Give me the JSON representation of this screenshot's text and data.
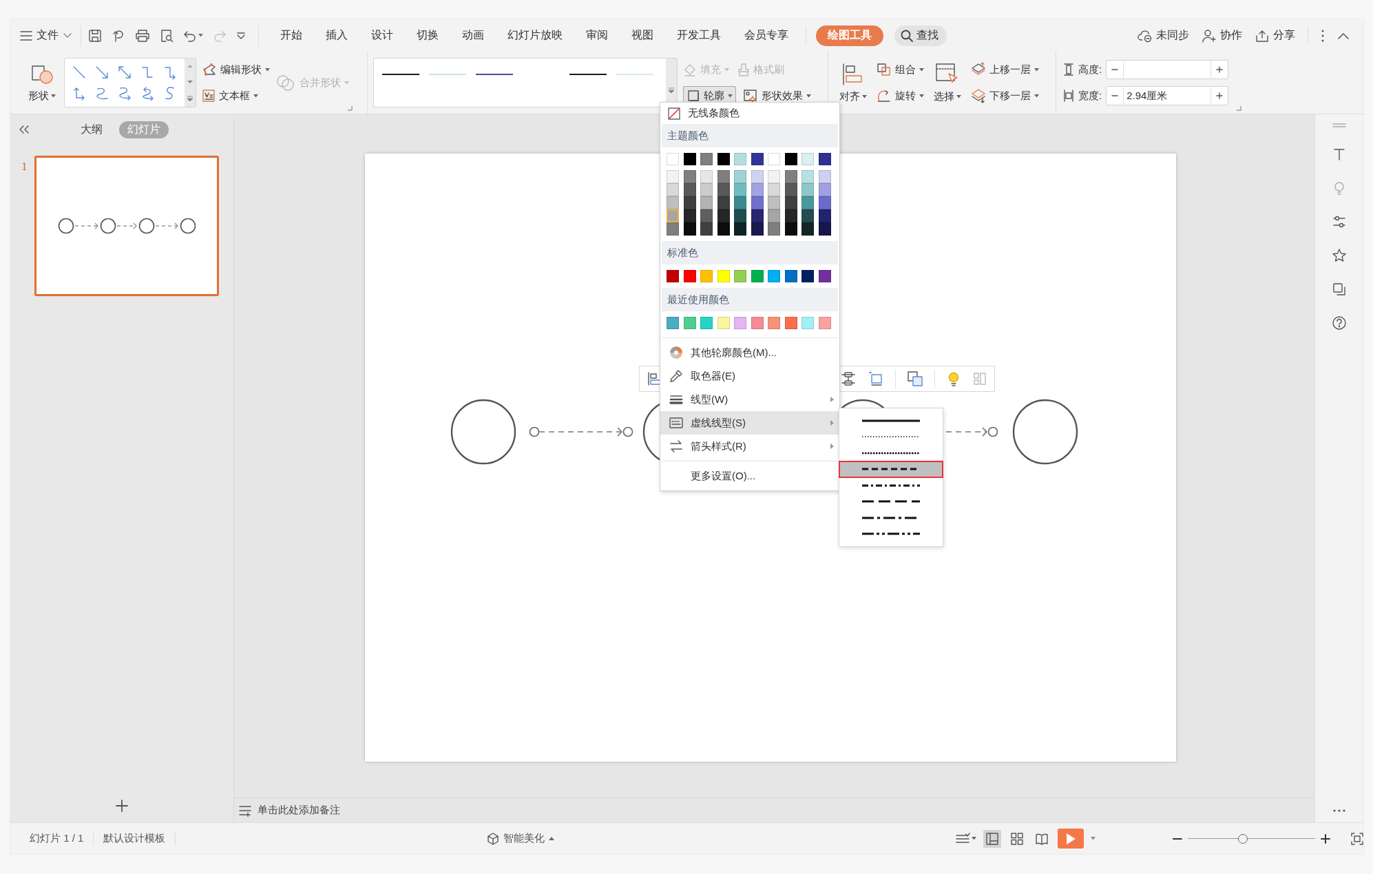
{
  "menu_bar": {
    "file_menu": "文件",
    "tabs": [
      {
        "label": "开始",
        "selected": false
      },
      {
        "label": "插入",
        "selected": false
      },
      {
        "label": "设计",
        "selected": false
      },
      {
        "label": "切换",
        "selected": false
      },
      {
        "label": "动画",
        "selected": false
      },
      {
        "label": "幻灯片放映",
        "selected": false
      },
      {
        "label": "审阅",
        "selected": false
      },
      {
        "label": "视图",
        "selected": false
      },
      {
        "label": "开发工具",
        "selected": false
      },
      {
        "label": "会员专享",
        "selected": false
      },
      {
        "label": "绘图工具",
        "selected": true
      }
    ],
    "search": "查找",
    "actions": [
      "未同步",
      "协作",
      "分享"
    ]
  },
  "ribbon": {
    "shape_button": "形状",
    "edit_shape": "编辑形状",
    "text_box": "文本框",
    "merge_shapes": {
      "label": "合并形状",
      "disabled": true
    },
    "style_gallery": [
      {
        "color": "#1a1a1a"
      },
      {
        "color": "#c8e4e6"
      },
      {
        "color": "#4b4ba8"
      },
      {
        "color": "#1a1a1a"
      },
      {
        "color": "#d6ecee"
      }
    ],
    "fill": {
      "label": "填充",
      "disabled": true
    },
    "format_painter": {
      "label": "格式刷",
      "disabled": true
    },
    "outline": {
      "label": "轮廓",
      "expanded": true
    },
    "shape_effects": "形状效果",
    "align": "对齐",
    "group": "组合",
    "rotate": "旋转",
    "select": "选择",
    "bring_forward": "上移一层",
    "send_backward": "下移一层",
    "height": {
      "label": "高度:"
    },
    "width": {
      "label": "宽度:",
      "value": "2.94厘米"
    }
  },
  "panel_tabs": [
    {
      "label": "大纲",
      "selected": false
    },
    {
      "label": "幻灯片",
      "selected": true
    }
  ],
  "slides": [
    {
      "number": "1",
      "selected": true
    }
  ],
  "notes_placeholder": "单击此处添加备注",
  "outline_menu": {
    "no_color": "无线条颜色",
    "sections": [
      {
        "title": "主题颜色",
        "rows": [
          [
            {
              "color": "#ffffff",
              "selected": false
            },
            {
              "color": "#000000",
              "selected": false
            },
            {
              "color": "#7f7f7f",
              "selected": false
            },
            {
              "color": "#000000",
              "selected": false
            },
            {
              "color": "#b4dde0",
              "selected": false
            },
            {
              "color": "#333399",
              "selected": false
            },
            {
              "color": "#ffffff",
              "selected": false
            },
            {
              "color": "#000000",
              "selected": false
            },
            {
              "color": "#dbeef0",
              "selected": false
            },
            {
              "color": "#2e3192",
              "selected": false
            }
          ],
          [
            {
              "color": "#f2f2f2",
              "selected": false
            },
            {
              "color": "#7f7f7f",
              "selected": false
            },
            {
              "color": "#e6e6e6",
              "selected": false
            },
            {
              "color": "#7f7f7f",
              "selected": false
            },
            {
              "color": "#9dd3d6",
              "selected": false
            },
            {
              "color": "#d1d1f0",
              "selected": false
            },
            {
              "color": "#f2f2f2",
              "selected": false
            },
            {
              "color": "#7f7f7f",
              "selected": false
            },
            {
              "color": "#b8dfe1",
              "selected": false
            },
            {
              "color": "#cfcff0",
              "selected": false
            }
          ],
          [
            {
              "color": "#d9d9d9",
              "selected": false
            },
            {
              "color": "#595959",
              "selected": false
            },
            {
              "color": "#cccccc",
              "selected": false
            },
            {
              "color": "#595959",
              "selected": false
            },
            {
              "color": "#6fbcc1",
              "selected": false
            },
            {
              "color": "#a3a3e0",
              "selected": false
            },
            {
              "color": "#d9d9d9",
              "selected": false
            },
            {
              "color": "#595959",
              "selected": false
            },
            {
              "color": "#8ec8cb",
              "selected": false
            },
            {
              "color": "#a0a0e0",
              "selected": false
            }
          ],
          [
            {
              "color": "#bfbfbf",
              "selected": false
            },
            {
              "color": "#3f3f3f",
              "selected": false
            },
            {
              "color": "#b3b3b3",
              "selected": false
            },
            {
              "color": "#3f3f3f",
              "selected": false
            },
            {
              "color": "#3b8a8e",
              "selected": false
            },
            {
              "color": "#7070cc",
              "selected": false
            },
            {
              "color": "#bfbfbf",
              "selected": false
            },
            {
              "color": "#3f3f3f",
              "selected": false
            },
            {
              "color": "#48999d",
              "selected": false
            },
            {
              "color": "#6b6bcc",
              "selected": false
            }
          ],
          [
            {
              "color": "#a6a6a6",
              "selected": true
            },
            {
              "color": "#262626",
              "selected": false
            },
            {
              "color": "#5f5f5f",
              "selected": false
            },
            {
              "color": "#262626",
              "selected": false
            },
            {
              "color": "#1f4d4f",
              "selected": false
            },
            {
              "color": "#262673",
              "selected": false
            },
            {
              "color": "#a6a6a6",
              "selected": false
            },
            {
              "color": "#262626",
              "selected": false
            },
            {
              "color": "#234c4e",
              "selected": false
            },
            {
              "color": "#22226e",
              "selected": false
            }
          ],
          [
            {
              "color": "#7f7f7f",
              "selected": false
            },
            {
              "color": "#0d0d0d",
              "selected": false
            },
            {
              "color": "#404040",
              "selected": false
            },
            {
              "color": "#0d0d0d",
              "selected": false
            },
            {
              "color": "#0e2324",
              "selected": false
            },
            {
              "color": "#19194d",
              "selected": false
            },
            {
              "color": "#7f7f7f",
              "selected": false
            },
            {
              "color": "#0d0d0d",
              "selected": false
            },
            {
              "color": "#122627",
              "selected": false
            },
            {
              "color": "#171749",
              "selected": false
            }
          ]
        ]
      },
      {
        "title": "标准色",
        "rows": [
          [
            {
              "color": "#c00000",
              "selected": false
            },
            {
              "color": "#ff0000",
              "selected": false
            },
            {
              "color": "#ffc000",
              "selected": false
            },
            {
              "color": "#ffff00",
              "selected": false
            },
            {
              "color": "#92d050",
              "selected": false
            },
            {
              "color": "#00b050",
              "selected": false
            },
            {
              "color": "#00b0f0",
              "selected": false
            },
            {
              "color": "#0070c0",
              "selected": false
            },
            {
              "color": "#002060",
              "selected": false
            },
            {
              "color": "#7030a0",
              "selected": false
            }
          ]
        ]
      },
      {
        "title": "最近使用颜色",
        "rows": [
          [
            {
              "color": "#4bacc6",
              "selected": false
            },
            {
              "color": "#4ecf8f",
              "selected": false
            },
            {
              "color": "#25d4c4",
              "selected": false
            },
            {
              "color": "#fbf5a0",
              "selected": false
            },
            {
              "color": "#e6b3f5",
              "selected": false
            },
            {
              "color": "#f68a95",
              "selected": false
            },
            {
              "color": "#f99178",
              "selected": false
            },
            {
              "color": "#fb6e4c",
              "selected": false
            },
            {
              "color": "#a0f0f8",
              "selected": false
            },
            {
              "color": "#fca0a0",
              "selected": false
            }
          ]
        ]
      }
    ],
    "items": [
      {
        "label": "其他轮廓颜色(M)...",
        "submenu": false,
        "highlighted": false
      },
      {
        "label": "取色器(E)",
        "submenu": false,
        "highlighted": false
      },
      {
        "label": "线型(W)",
        "submenu": true,
        "highlighted": false
      },
      {
        "label": "虚线线型(S)",
        "submenu": true,
        "highlighted": true
      },
      {
        "label": "箭头样式(R)",
        "submenu": true,
        "highlighted": false
      },
      {
        "label": "更多设置(O)...",
        "submenu": false,
        "highlighted": false
      }
    ]
  },
  "dash_submenu": [
    {
      "kind": "solid",
      "selected": false
    },
    {
      "kind": "round-dot",
      "selected": false
    },
    {
      "kind": "square-dot",
      "selected": false
    },
    {
      "kind": "dash",
      "selected": true
    },
    {
      "kind": "dash-dot",
      "selected": false
    },
    {
      "kind": "long-dash",
      "selected": false
    },
    {
      "kind": "long-dash-dot",
      "selected": false
    },
    {
      "kind": "long-dash-dot-dot",
      "selected": false
    }
  ],
  "status_bar": {
    "slide_counter": "幻灯片 1 / 1",
    "template": "默认设计模板",
    "smart_beautify": "智能美化",
    "views": [
      {
        "selected": true
      },
      {
        "selected": false
      },
      {
        "selected": false
      }
    ],
    "zoom_slider": {
      "level": 0.43
    }
  }
}
